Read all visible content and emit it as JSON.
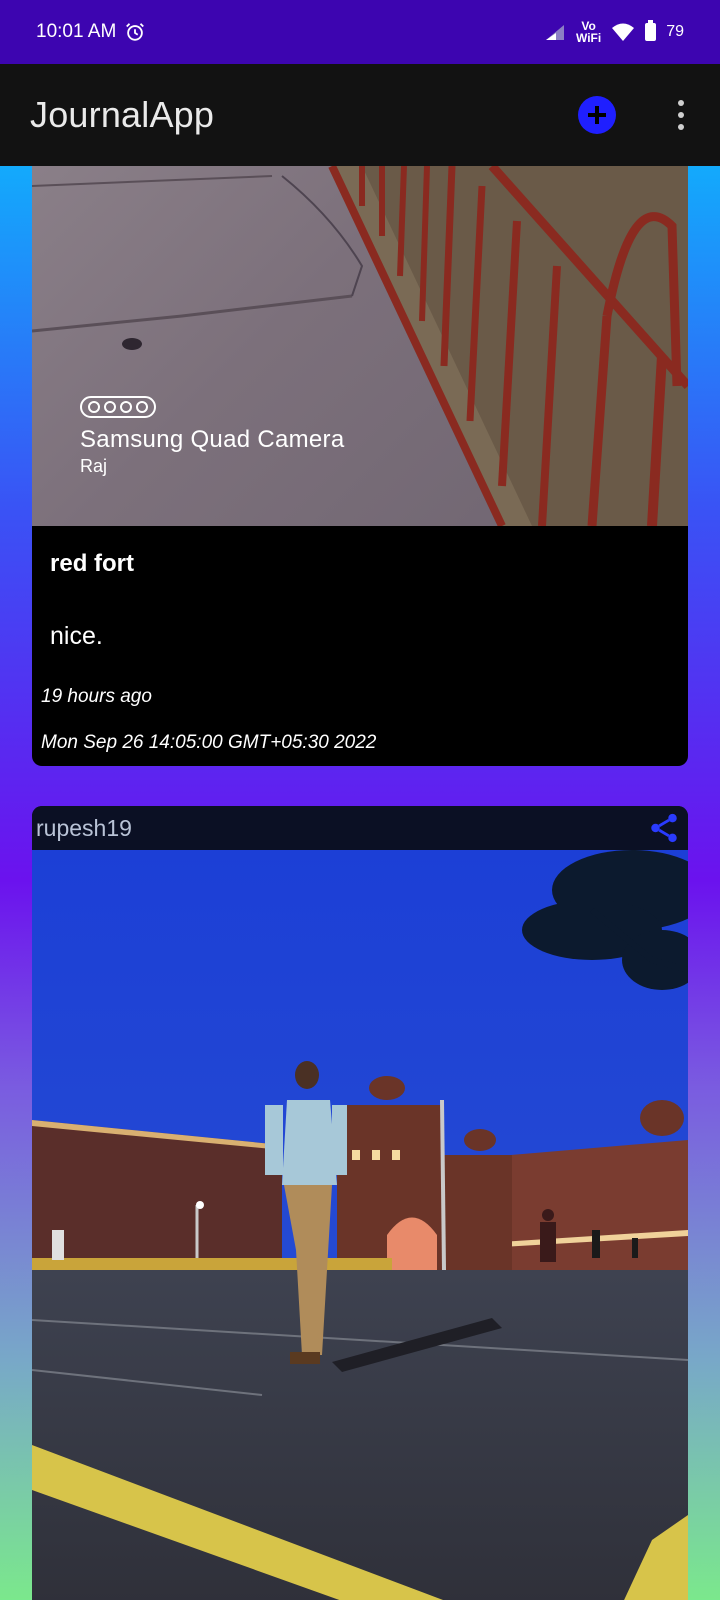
{
  "status_bar": {
    "time": "10:01 AM",
    "vowifi_top": "Vo",
    "vowifi_bottom": "WiFi",
    "battery": "79",
    "icons": [
      "alarm-icon",
      "signal-icon",
      "wifi-icon",
      "battery-icon"
    ]
  },
  "app_bar": {
    "title": "JournalApp",
    "add_icon": "add-circle-icon",
    "menu_icon": "more-vert-icon",
    "accent_color": "#1f1fff"
  },
  "posts": [
    {
      "watermark_camera": "Samsung Quad Camera",
      "watermark_name": "Raj",
      "title": "red fort",
      "description": "nice.",
      "time_ago": "19 hours ago",
      "date": "Mon Sep 26 14:05:00 GMT+05:30 2022"
    },
    {
      "username": "rupesh19",
      "share_icon": "share-icon"
    }
  ]
}
